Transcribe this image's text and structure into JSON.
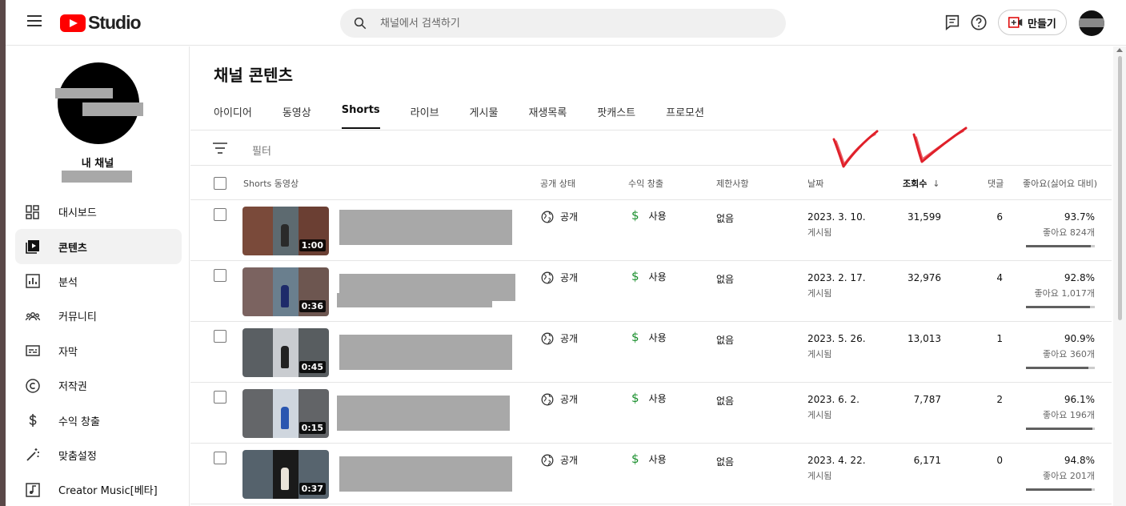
{
  "header": {
    "logo_text": "Studio",
    "search_placeholder": "채널에서 검색하기",
    "create_label": "만들기"
  },
  "sidebar": {
    "channel_label": "내 채널",
    "items": [
      {
        "label": "대시보드",
        "icon": "dashboard-icon"
      },
      {
        "label": "콘텐츠",
        "icon": "content-icon",
        "active": true
      },
      {
        "label": "분석",
        "icon": "analytics-icon"
      },
      {
        "label": "커뮤니티",
        "icon": "community-icon"
      },
      {
        "label": "자막",
        "icon": "subtitles-icon"
      },
      {
        "label": "저작권",
        "icon": "copyright-icon"
      },
      {
        "label": "수익 창출",
        "icon": "dollar-icon"
      },
      {
        "label": "맞춤설정",
        "icon": "magic-wand-icon"
      },
      {
        "label": "Creator Music[베타]",
        "icon": "music-icon"
      }
    ]
  },
  "main": {
    "title": "채널 콘텐츠",
    "tabs": [
      "아이디어",
      "동영상",
      "Shorts",
      "라이브",
      "게시물",
      "재생목록",
      "팟캐스트",
      "프로모션"
    ],
    "active_tab": "Shorts",
    "filter_label": "필터",
    "columns": {
      "video": "Shorts 동영상",
      "visibility": "공개 상태",
      "monetization": "수익 창출",
      "restrictions": "제한사항",
      "date": "날짜",
      "views": "조회수",
      "views_sort": "↓",
      "comments": "댓글",
      "likes": "좋아요(싫어요 대비)"
    },
    "rows": [
      {
        "duration": "1:00",
        "visibility": "공개",
        "monetization": "사용",
        "restrictions": "없음",
        "date": "2023. 3. 10.",
        "date_sub": "게시됨",
        "views": "31,599",
        "comments": "6",
        "like_pct": "93.7%",
        "like_count": "좋아요 824개",
        "like_ratio": 0.937
      },
      {
        "duration": "0:36",
        "visibility": "공개",
        "monetization": "사용",
        "restrictions": "없음",
        "date": "2023. 2. 17.",
        "date_sub": "게시됨",
        "views": "32,976",
        "comments": "4",
        "like_pct": "92.8%",
        "like_count": "좋아요 1,017개",
        "like_ratio": 0.928
      },
      {
        "duration": "0:45",
        "visibility": "공개",
        "monetization": "사용",
        "restrictions": "없음",
        "date": "2023. 5. 26.",
        "date_sub": "게시됨",
        "views": "13,013",
        "comments": "1",
        "like_pct": "90.9%",
        "like_count": "좋아요 360개",
        "like_ratio": 0.909
      },
      {
        "duration": "0:15",
        "visibility": "공개",
        "monetization": "사용",
        "restrictions": "없음",
        "date": "2023. 6. 2.",
        "date_sub": "게시됨",
        "views": "7,787",
        "comments": "2",
        "like_pct": "96.1%",
        "like_count": "좋아요 196개",
        "like_ratio": 0.961
      },
      {
        "duration": "0:37",
        "visibility": "공개",
        "monetization": "사용",
        "restrictions": "없음",
        "date": "2023. 4. 22.",
        "date_sub": "게시됨",
        "views": "6,171",
        "comments": "0",
        "like_pct": "94.8%",
        "like_count": "좋아요 201개",
        "like_ratio": 0.948
      }
    ]
  },
  "colors": {
    "brand_red": "#ff0000",
    "monetization_green": "#1a8f2d",
    "annotation_red": "#e0202a"
  }
}
